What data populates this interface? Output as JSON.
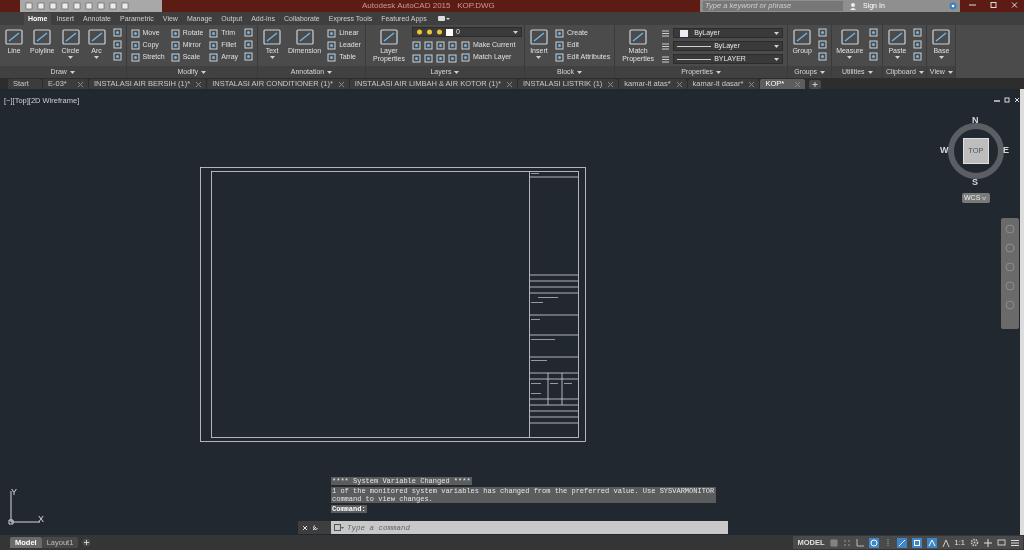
{
  "title_bar": {
    "title": "Autodesk AutoCAD 2015   KOP.DWG",
    "search_placeholder": "Type a keyword or phrase",
    "sign_in": "Sign In"
  },
  "ribbon_tabs": [
    {
      "label": "Home",
      "selected": true
    },
    {
      "label": "Insert",
      "selected": false
    },
    {
      "label": "Annotate",
      "selected": false
    },
    {
      "label": "Parametric",
      "selected": false
    },
    {
      "label": "View",
      "selected": false
    },
    {
      "label": "Manage",
      "selected": false
    },
    {
      "label": "Output",
      "selected": false
    },
    {
      "label": "Add-ins",
      "selected": false
    },
    {
      "label": "Collaborate",
      "selected": false
    },
    {
      "label": "Express Tools",
      "selected": false
    },
    {
      "label": "Featured Apps",
      "selected": false
    }
  ],
  "ribbon_panels": [
    {
      "title": "Draw",
      "items": [
        {
          "kind": "large",
          "label": "Line",
          "menu": false
        },
        {
          "kind": "large",
          "label": "Polyline",
          "menu": false
        },
        {
          "kind": "large",
          "label": "Circle",
          "menu": true
        },
        {
          "kind": "large",
          "label": "Arc",
          "menu": true
        },
        {
          "kind": "icon_column"
        }
      ]
    },
    {
      "title": "Modify",
      "items": [
        {
          "kind": "column",
          "buttons": [
            "Move",
            "Copy",
            "Stretch"
          ]
        },
        {
          "kind": "column",
          "buttons": [
            "Rotate",
            "Mirror",
            "Scale"
          ]
        },
        {
          "kind": "column",
          "buttons": [
            "Trim",
            "Fillet",
            "Array"
          ]
        },
        {
          "kind": "icon_column"
        }
      ]
    },
    {
      "title": "Annotation",
      "items": [
        {
          "kind": "large",
          "label": "Text",
          "menu": true
        },
        {
          "kind": "large",
          "label": "Dimension",
          "menu": false
        },
        {
          "kind": "column",
          "buttons": [
            "Linear",
            "Leader",
            "Table"
          ]
        }
      ]
    },
    {
      "title": "Layers",
      "items": [
        {
          "kind": "large",
          "label": "Layer Properties",
          "menu": false
        },
        {
          "kind": "layer_stack",
          "layer": "0",
          "buttons": [
            "Make Current",
            "Match Layer"
          ]
        }
      ]
    },
    {
      "title": "Block",
      "items": [
        {
          "kind": "large",
          "label": "Insert",
          "menu": true
        },
        {
          "kind": "column",
          "buttons": [
            "Create",
            "Edit",
            "Edit Attributes"
          ]
        }
      ]
    },
    {
      "title": "Properties",
      "items": [
        {
          "kind": "large",
          "label": "Match Properties",
          "menu": false
        },
        {
          "kind": "dropdown_stack",
          "rows": [
            {
              "kind": "color",
              "value": "ByLayer"
            },
            {
              "kind": "linetype",
              "value": "ByLayer"
            },
            {
              "kind": "lineweight",
              "value": "BYLAYER"
            }
          ]
        }
      ]
    },
    {
      "title": "Groups",
      "items": [
        {
          "kind": "large",
          "label": "Group",
          "menu": false
        },
        {
          "kind": "icon_column"
        }
      ]
    },
    {
      "title": "Utilities",
      "items": [
        {
          "kind": "large",
          "label": "Measure",
          "menu": true
        },
        {
          "kind": "icon_column"
        }
      ]
    },
    {
      "title": "Clipboard",
      "items": [
        {
          "kind": "large",
          "label": "Paste",
          "menu": true
        },
        {
          "kind": "icon_column"
        }
      ]
    },
    {
      "title": "View",
      "items": [
        {
          "kind": "large",
          "label": "Base",
          "menu": true
        }
      ]
    }
  ],
  "file_tabs": [
    {
      "label": "Start",
      "selected": false
    },
    {
      "label": "E-03*",
      "selected": false
    },
    {
      "label": "INSTALASI AIR BERSIH (1)*",
      "selected": false
    },
    {
      "label": "INSTALASI AIR CONDITIONER (1)*",
      "selected": false
    },
    {
      "label": "INSTALASI AIR LIMBAH & AIR KOTOR (1)*",
      "selected": false
    },
    {
      "label": "INSTALASI LISTRIK (1)",
      "selected": false
    },
    {
      "label": "kamar-lt atas*",
      "selected": false
    },
    {
      "label": "kamar-lt dasar*",
      "selected": false
    },
    {
      "label": "KOP*",
      "selected": true
    }
  ],
  "viewport": {
    "label": "[−][Top][2D Wireframe]",
    "viewcube": {
      "north": "N",
      "south": "S",
      "east": "E",
      "west": "W",
      "face": "TOP",
      "ucs": "WCS"
    },
    "ucs_axes": {
      "x": "X",
      "y": "Y"
    }
  },
  "command_line": {
    "history": [
      "**** System Variable Changed ****",
      "1 of the monitored system variables has changed from the preferred value. Use SYSVARMONITOR command to view changes."
    ],
    "prompt": "Command:",
    "placeholder": "Type a command"
  },
  "layout_tabs": [
    {
      "label": "Model",
      "selected": true
    },
    {
      "label": "Layout1",
      "selected": false
    }
  ],
  "status_bar": {
    "space": "MODEL",
    "scale": "1:1"
  }
}
